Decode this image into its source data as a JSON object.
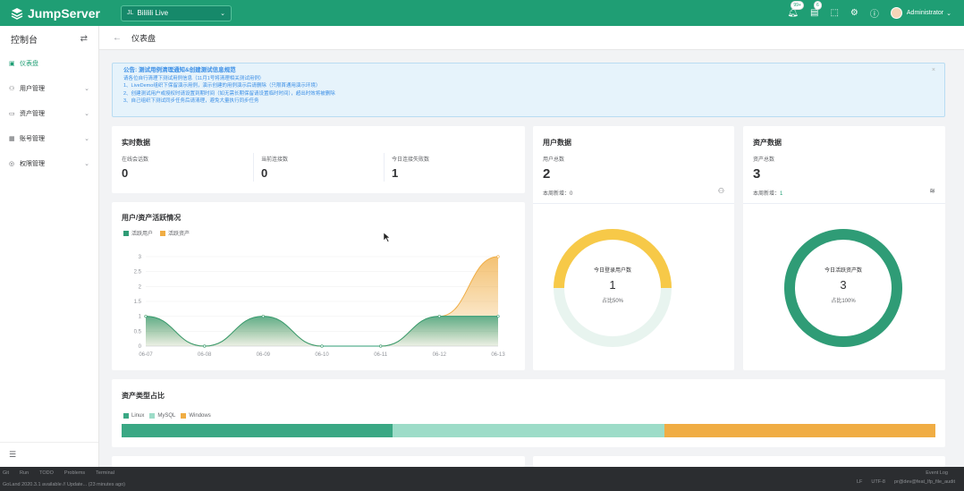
{
  "topbar": {
    "brand": "JumpServer",
    "org_prefix": "JL",
    "org_name": "Bililili Live",
    "badges": {
      "messages": "99+",
      "tickets": "6"
    },
    "user": "Administrator"
  },
  "sidebar": {
    "title": "控制台",
    "items": [
      {
        "label": "仪表盘",
        "icon": "dashboard-icon"
      },
      {
        "label": "用户管理",
        "icon": "user-icon"
      },
      {
        "label": "资产管理",
        "icon": "asset-icon"
      },
      {
        "label": "账号管理",
        "icon": "account-icon"
      },
      {
        "label": "权限管理",
        "icon": "permission-icon"
      }
    ]
  },
  "page": {
    "title": "仪表盘"
  },
  "notice": {
    "title": "公告: 测试用例清理通知&创建测试信息规范",
    "lines": [
      "请各位自行清理下测试用例信息（11月1号将清理相关测试用例）",
      "1、LiveDemo组织下保留演示用例，演示创建的用例演示后请删除（只限首通用演示环境）",
      "2、创建测试用户或授权时请设置到期时间（如无需长期保留请设置临时时间），超出时效将被删除",
      "3、自己组织下测试同步任务后请清理，避免大量执行同步任务"
    ]
  },
  "realtime": {
    "title": "实时数据",
    "stats": [
      {
        "label": "在线会话数",
        "value": "0"
      },
      {
        "label": "当前连接数",
        "value": "0"
      },
      {
        "label": "今日连接失败数",
        "value": "1"
      }
    ]
  },
  "user_data": {
    "title": "用户数据",
    "total_label": "用户总数",
    "total": "2",
    "weekly_label": "本周新增：",
    "weekly": "0"
  },
  "asset_data": {
    "title": "资产数据",
    "total_label": "资产总数",
    "total": "3",
    "weekly_label": "本周新增：",
    "weekly": "1"
  },
  "activity": {
    "title": "用户/资产活跃情况",
    "legend": [
      "活跃用户",
      "活跃资产"
    ]
  },
  "donut_users": {
    "label": "今日登录用户数",
    "value": "1",
    "ratio": "占比50%",
    "fraction": 0.5,
    "color": "#f7c948"
  },
  "donut_assets": {
    "label": "今日活跃资产数",
    "value": "3",
    "ratio": "占比100%",
    "fraction": 1.0,
    "color": "#2f9c76"
  },
  "asset_types": {
    "title": "资产类型占比",
    "items": [
      {
        "name": "Linux",
        "fraction": 0.3333,
        "color": "#3aa884"
      },
      {
        "name": "MySQL",
        "fraction": 0.3333,
        "color": "#9ddcc8"
      },
      {
        "name": "Windows",
        "fraction": 0.3334,
        "color": "#f0ad44"
      }
    ]
  },
  "chart_data": {
    "type": "area",
    "categories": [
      "06-07",
      "06-08",
      "06-09",
      "06-10",
      "06-11",
      "06-12",
      "06-13"
    ],
    "ylim": [
      0,
      3
    ],
    "yticks": [
      "0",
      "0.5",
      "1",
      "1.5",
      "2",
      "2.5",
      "3"
    ],
    "series": [
      {
        "name": "活跃用户",
        "color": "#2f9c76",
        "values": [
          1,
          0,
          1,
          0,
          0,
          1,
          1
        ]
      },
      {
        "name": "活跃资产",
        "color": "#f0ad44",
        "values": [
          1,
          0,
          1,
          0,
          0,
          1,
          3
        ]
      }
    ]
  },
  "taskbar": {
    "tabs": [
      "Git",
      "Run",
      "TODO",
      "Problems",
      "Terminal"
    ],
    "status": "GoLand 2020.3.1 available // Update... (23 minutes ago)",
    "right": [
      "LF",
      "UTF-8",
      "pr@dev@feat_lfp_file_audit"
    ],
    "event_log": "Event Log"
  }
}
